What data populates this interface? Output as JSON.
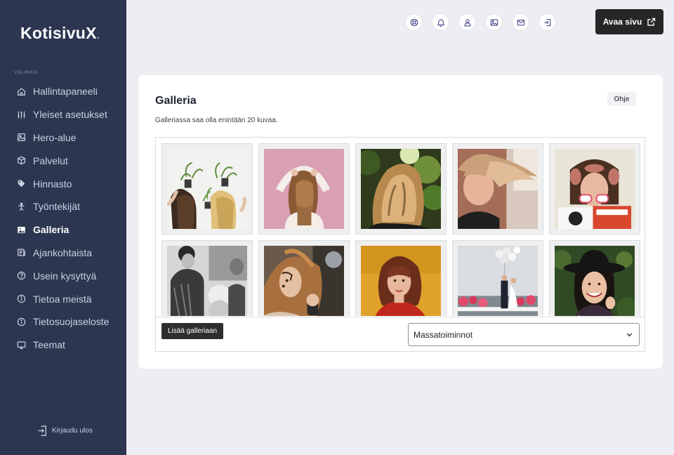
{
  "app": {
    "logo": "KotisivuX",
    "logo_dot": "."
  },
  "sidebar": {
    "heading": "VALIKKO",
    "items": [
      {
        "label": "Hallintapaneeli",
        "icon": "home-icon"
      },
      {
        "label": "Yleiset asetukset",
        "icon": "sliders-icon"
      },
      {
        "label": "Hero-alue",
        "icon": "hero-image-icon"
      },
      {
        "label": "Palvelut",
        "icon": "box-icon"
      },
      {
        "label": "Hinnasto",
        "icon": "tag-icon"
      },
      {
        "label": "Työntekijät",
        "icon": "person-icon"
      },
      {
        "label": "Galleria",
        "icon": "image-icon",
        "active": true
      },
      {
        "label": "Ajankohtaista",
        "icon": "newspaper-icon"
      },
      {
        "label": "Usein kysyttyä",
        "icon": "question-icon"
      },
      {
        "label": "Tietoa meistä",
        "icon": "info-icon"
      },
      {
        "label": "Tietosuojaseloste",
        "icon": "info-icon"
      },
      {
        "label": "Teemat",
        "icon": "monitor-icon"
      }
    ],
    "logout_label": "Kirjaudu ulos"
  },
  "topbar": {
    "icons": [
      "support-icon",
      "bell-icon",
      "user-icon",
      "image-icon",
      "mail-icon",
      "logout-icon"
    ],
    "open_site_label": "Avaa sivu"
  },
  "gallery": {
    "title": "Galleria",
    "help_label": "Ohje",
    "description": "Galleriassa saa olla enintään 20 kuvaa.",
    "add_button_label": "Lisää galleriaan",
    "bulk_actions_label": "Massatoiminnot",
    "photos": [
      "two-women-with-plants-photo",
      "hands-in-hair-pink-photo",
      "wavy-hair-greenery-photo",
      "blonde-wind-hair-photo",
      "curlers-sunglasses-photo",
      "vintage-salon-photo",
      "makeup-artist-photo",
      "red-sweater-woman-photo",
      "wedding-balloons-photo",
      "black-hat-smile-photo"
    ]
  }
}
